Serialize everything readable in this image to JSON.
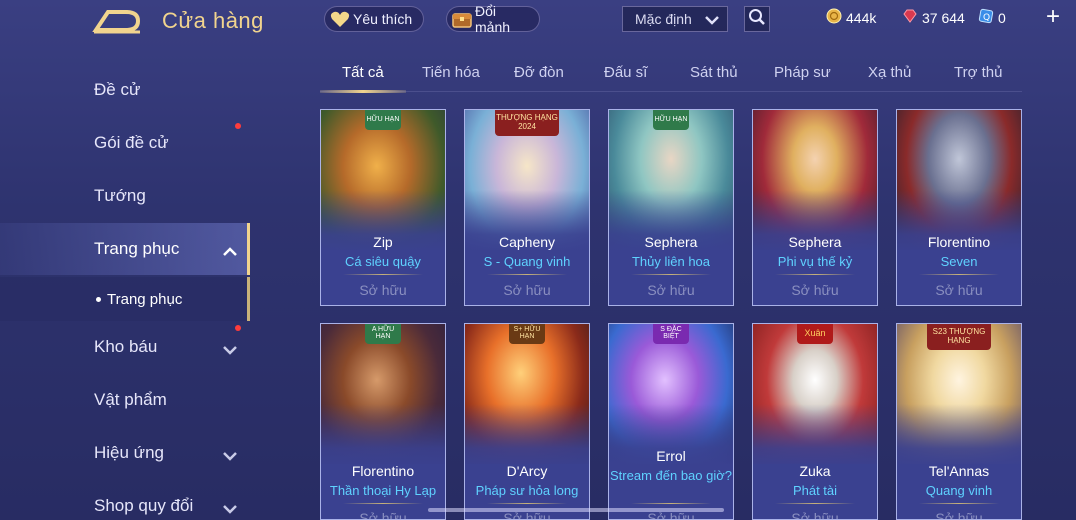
{
  "header": {
    "title": "Cửa hàng",
    "favorites_label": "Yêu thích",
    "shards_label": "Đổi mảnh",
    "sort_value": "Mặc định",
    "gold": "444k",
    "rubies": "37 644",
    "vouchers": "0"
  },
  "sidebar": {
    "items": [
      {
        "label": "Đề cử"
      },
      {
        "label": "Gói đề cử"
      },
      {
        "label": "Tướng"
      },
      {
        "label": "Trang phục"
      },
      {
        "label": "Kho báu"
      },
      {
        "label": "Vật phẩm"
      },
      {
        "label": "Hiệu ứng"
      },
      {
        "label": "Shop quy đổi"
      }
    ],
    "sub_item": "Trang phục"
  },
  "tabs": [
    {
      "label": "Tất cả"
    },
    {
      "label": "Tiến hóa"
    },
    {
      "label": "Đỡ đòn"
    },
    {
      "label": "Đấu sĩ"
    },
    {
      "label": "Sát thủ"
    },
    {
      "label": "Pháp sư"
    },
    {
      "label": "Xạ thủ"
    },
    {
      "label": "Trợ thủ"
    }
  ],
  "cards": [
    {
      "hero": "Zip",
      "skin": "Cá siêu quậy",
      "status": "Sở hữu",
      "badge": "HỮU HẠN"
    },
    {
      "hero": "Capheny",
      "skin": "S - Quang vinh",
      "status": "Sở hữu",
      "badge": "THƯỢNG HẠNG 2024"
    },
    {
      "hero": "Sephera",
      "skin": "Thủy liên hoa",
      "status": "Sở hữu",
      "badge": "HỮU HẠN"
    },
    {
      "hero": "Sephera",
      "skin": "Phi vụ thế kỷ",
      "status": "Sở hữu",
      "badge": ""
    },
    {
      "hero": "Florentino",
      "skin": "Seven",
      "status": "Sở hữu",
      "badge": ""
    },
    {
      "hero": "Florentino",
      "skin": "Thần thoại Hy Lạp",
      "status": "Sở hữu",
      "badge": "A HỮU HẠN"
    },
    {
      "hero": "D'Arcy",
      "skin": "Pháp sư hỏa long",
      "status": "Sở hữu",
      "badge": "S+ HỮU HẠN"
    },
    {
      "hero": "Errol",
      "skin": "Stream đến bao giờ?",
      "status": "Sở hữu",
      "badge": "S ĐẶC BIỆT"
    },
    {
      "hero": "Zuka",
      "skin": "Phát tài",
      "status": "Sở hữu",
      "badge": "Xuân"
    },
    {
      "hero": "Tel'Annas",
      "skin": "Quang vinh",
      "status": "Sở hữu",
      "badge": "S23 THƯỢNG HẠNG"
    }
  ],
  "colors": {
    "accent_gold": "#f1d48e",
    "skin_name": "#5fd2ff",
    "background": "#2e336f"
  },
  "icons": {
    "favorite": "heart-icon",
    "shards": "chest-icon",
    "search": "search-icon",
    "gold": "gold-coin-icon",
    "ruby": "ruby-icon",
    "voucher": "voucher-icon"
  }
}
